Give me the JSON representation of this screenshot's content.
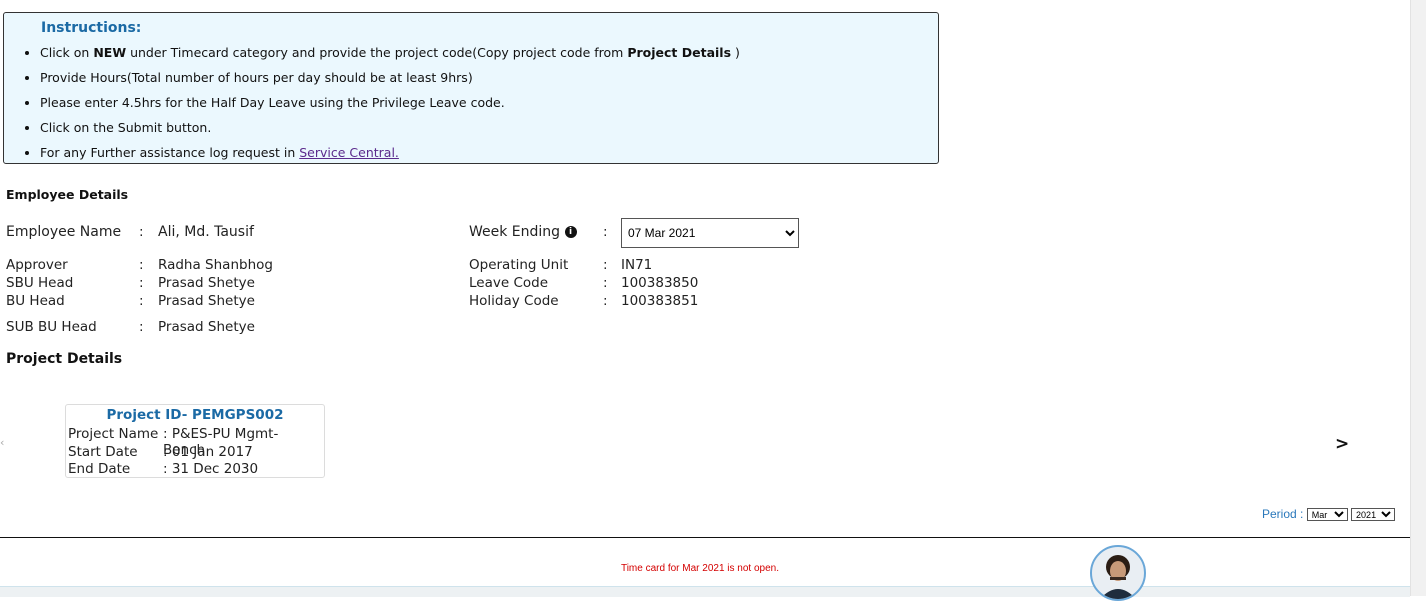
{
  "instructions": {
    "title": "Instructions:",
    "items": [
      {
        "pre": "Click on ",
        "bold1": "NEW",
        "mid": " under Timecard category and provide the project code(Copy project code from ",
        "bold2": "Project Details",
        "post": " )"
      },
      {
        "text": "Provide Hours(Total number of hours per day should be at least 9hrs)"
      },
      {
        "text": "Please enter 4.5hrs for the Half Day Leave using the Privilege Leave code."
      },
      {
        "text": "Click on the Submit button."
      },
      {
        "pre": "For any Further assistance log request in ",
        "link": "Service Central."
      }
    ]
  },
  "employee": {
    "section_title": "Employee Details",
    "name_label": "Employee Name",
    "name_value": "Ali, Md. Tausif",
    "approver_label": "Approver",
    "approver_value": "Radha Shanbhog",
    "sbu_label": "SBU Head",
    "sbu_value": "Prasad Shetye",
    "bu_label": "BU Head",
    "bu_value": "Prasad Shetye",
    "subbu_label": "SUB BU Head",
    "subbu_value": "Prasad Shetye",
    "week_label": "Week Ending",
    "week_value": "07 Mar 2021",
    "ou_label": "Operating Unit",
    "ou_value": "IN71",
    "leave_label": "Leave Code",
    "leave_value": "100383850",
    "holiday_label": "Holiday Code",
    "holiday_value": "100383851",
    "colon": ":"
  },
  "project": {
    "section_title": "Project Details",
    "card_title": "Project ID- PEMGPS002",
    "name_label": "Project Name",
    "name_value": ": P&ES-PU Mgmt- Bench",
    "start_label": "Start Date",
    "start_value": ": 01 Jan 2017",
    "end_label": "End Date",
    "end_value": ": 31 Dec 2030",
    "next_arrow": ">"
  },
  "period": {
    "label": "Period :",
    "month": "Mar",
    "year": "2021"
  },
  "notice": "Time card for Mar 2021 is not open.",
  "colors": {
    "accent": "#1b6aa5",
    "error": "#d40000",
    "instructions_bg": "#ebf8fe"
  }
}
